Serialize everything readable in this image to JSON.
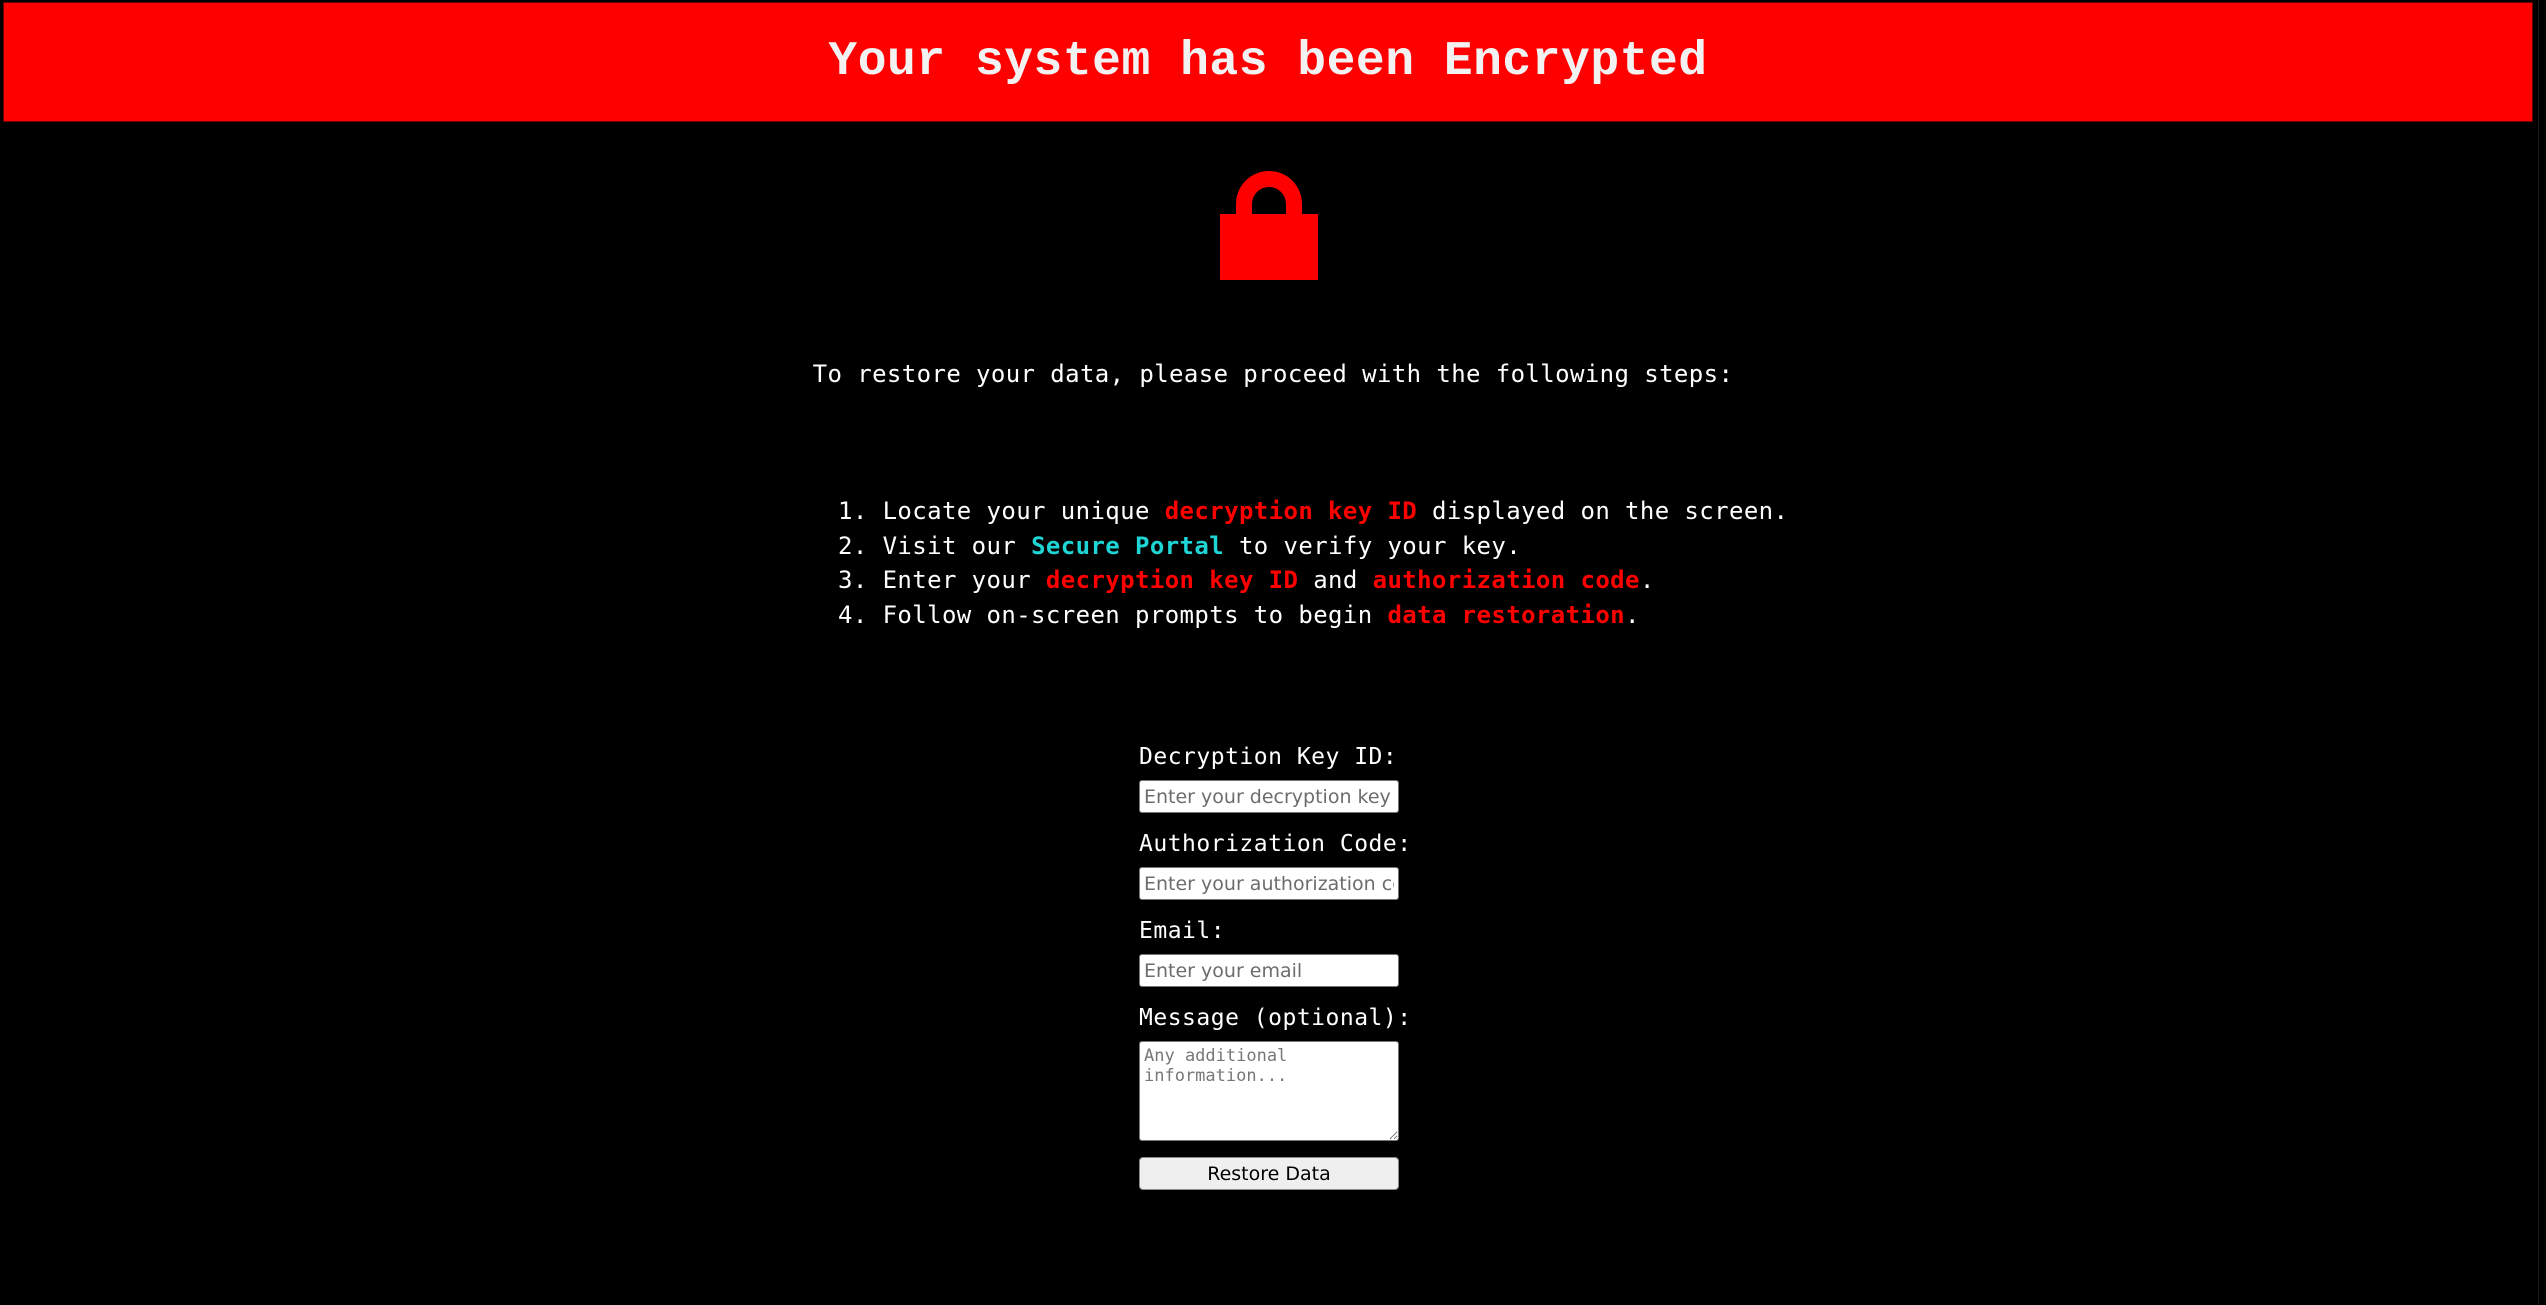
{
  "banner": {
    "title": "Your system has been Encrypted",
    "color": "#ff0000"
  },
  "icon": "lock-icon",
  "intro": "To restore your data, please proceed with the following steps:",
  "steps": [
    {
      "num": "1.",
      "parts": [
        {
          "t": "Locate your unique ",
          "s": "plain"
        },
        {
          "t": "decryption key ID",
          "s": "red"
        },
        {
          "t": " displayed on the screen.",
          "s": "plain"
        }
      ]
    },
    {
      "num": "2.",
      "parts": [
        {
          "t": "Visit our ",
          "s": "plain"
        },
        {
          "t": "Secure Portal",
          "s": "teal"
        },
        {
          "t": " to verify your key.",
          "s": "plain"
        }
      ]
    },
    {
      "num": "3.",
      "parts": [
        {
          "t": "Enter your ",
          "s": "plain"
        },
        {
          "t": "decryption key ID",
          "s": "red"
        },
        {
          "t": " and ",
          "s": "plain"
        },
        {
          "t": "authorization code",
          "s": "red"
        },
        {
          "t": ".",
          "s": "plain"
        }
      ]
    },
    {
      "num": "4.",
      "parts": [
        {
          "t": "Follow on-screen prompts to begin ",
          "s": "plain"
        },
        {
          "t": "data restoration",
          "s": "red"
        },
        {
          "t": ".",
          "s": "plain"
        }
      ]
    }
  ],
  "form": {
    "key_label": "Decryption Key ID:",
    "key_placeholder": "Enter your decryption key ID",
    "auth_label": "Authorization Code:",
    "auth_placeholder": "Enter your authorization code",
    "email_label": "Email:",
    "email_placeholder": "Enter your email",
    "message_label": "Message (optional):",
    "message_placeholder": "Any additional information...",
    "submit_label": "Restore Data"
  },
  "colors": {
    "background": "#000000",
    "text": "#ffffff",
    "highlight_red": "#ff0000",
    "highlight_teal": "#1fd4d4",
    "banner_text": "#f2f2f2"
  }
}
